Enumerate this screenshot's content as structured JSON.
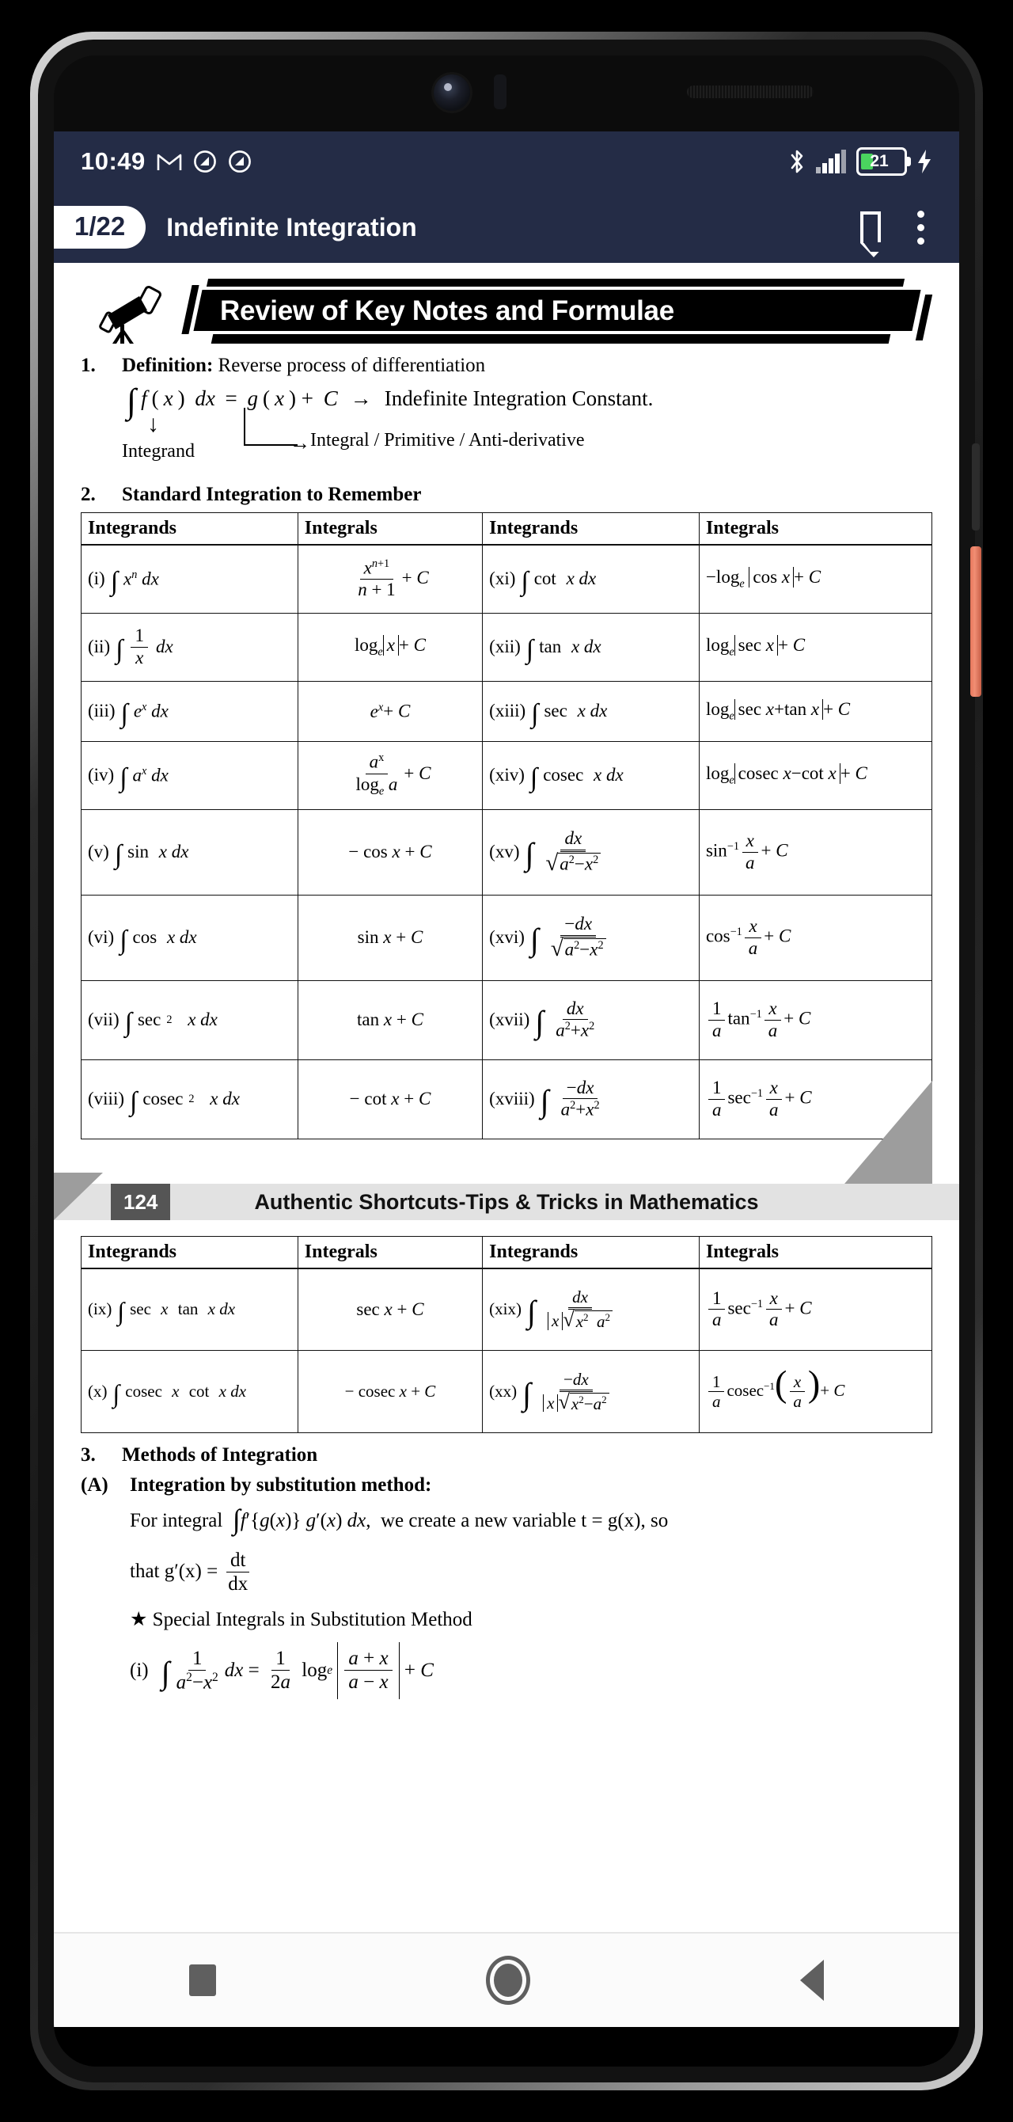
{
  "status_bar": {
    "time": "10:49",
    "left_icons": [
      "gmail-icon",
      "qr-app-icon",
      "qr-app-icon"
    ],
    "right_icons": [
      "bluetooth-icon",
      "signal-icon",
      "battery-icon",
      "charging-bolt-icon"
    ],
    "battery_percent": "21",
    "battery_color": "#4ad45f",
    "background": "#242c46"
  },
  "app_bar": {
    "page_badge": "1/22",
    "title": "Indefinite Integration",
    "bookmark_label": "bookmark-icon",
    "overflow_label": "more-options-icon"
  },
  "document": {
    "banner_title": "Review of Key Notes and Formulae",
    "section1": {
      "number": "1.",
      "label": "Definition:",
      "text": "Reverse process of differentiation",
      "equation_lhs": "∫ f(x) dx = g(x) + C",
      "equation_arrow": "→",
      "equation_rhs": "Indefinite Integration Constant.",
      "annot_integrand": "Integrand",
      "annot_integral": "Integral / Primitive / Anti-derivative"
    },
    "section2": {
      "number": "2.",
      "title": "Standard Integration to Remember",
      "headers": [
        "Integrands",
        "Integrals",
        "Integrands",
        "Integrals"
      ],
      "rows": [
        {
          "i1": "(i)",
          "f1": "∫ xⁿ dx",
          "r1": "x^(n+1)/(n+1) + C",
          "i2": "(xi)",
          "f2": "∫ cot x dx",
          "r2": "−log_e |cos x| + C"
        },
        {
          "i1": "(ii)",
          "f1": "∫ (1/x) dx",
          "r1": "log_e |x| + C",
          "i2": "(xii)",
          "f2": "∫ tan x dx",
          "r2": "log_e |sec x| + C"
        },
        {
          "i1": "(iii)",
          "f1": "∫ eˣ dx",
          "r1": "eˣ + C",
          "i2": "(xiii)",
          "f2": "∫ sec x dx",
          "r2": "log_e |sec x + tan x| + C"
        },
        {
          "i1": "(iv)",
          "f1": "∫ aˣ dx",
          "r1": "aˣ/log_e a + C",
          "i2": "(xiv)",
          "f2": "∫ cosec x dx",
          "r2": "log_e |cosec x − cot x| + C"
        },
        {
          "i1": "(v)",
          "f1": "∫ sin x dx",
          "r1": "− cos x + C",
          "i2": "(xv)",
          "f2": "∫ dx/√(a²−x²)",
          "r2": "sin⁻¹ (x/a) + C"
        },
        {
          "i1": "(vi)",
          "f1": "∫ cos x dx",
          "r1": "sin x + C",
          "i2": "(xvi)",
          "f2": "∫ −dx/√(a²−x²)",
          "r2": "cos⁻¹ (x/a) + C"
        },
        {
          "i1": "(vii)",
          "f1": "∫ sec² x dx",
          "r1": "tan x + C",
          "i2": "(xvii)",
          "f2": "∫ dx/(a²+x²)",
          "r2": "(1/a) tan⁻¹ (x/a) + C"
        },
        {
          "i1": "(viii)",
          "f1": "∫ cosec² x dx",
          "r1": "− cot x + C",
          "i2": "(xviii)",
          "f2": "∫ −dx/(a²+x²)",
          "r2": "(1/a) sec⁻¹ (x/a) + C"
        }
      ]
    },
    "page_footer": {
      "page_number": "124",
      "title": "Authentic Shortcuts-Tips & Tricks in Mathematics"
    },
    "table2": {
      "headers": [
        "Integrands",
        "Integrals",
        "Integrands",
        "Integrals"
      ],
      "rows": [
        {
          "i1": "(ix)",
          "f1": "∫ sec x tan x dx",
          "r1": "sec x + C",
          "i2": "(xix)",
          "f2": "∫ dx/(|x|√(x² a²))",
          "r2": "(1/a) sec⁻¹ (x/a) + C"
        },
        {
          "i1": "(x)",
          "f1": "∫ cosec x cot x dx",
          "r1": "− cosec x + C",
          "i2": "(xx)",
          "f2": "∫ −dx/(|x|√(x²−a²))",
          "r2": "(1/a) cosec⁻¹ (x/a) + C"
        }
      ]
    },
    "section3": {
      "number": "3.",
      "title": "Methods of Integration",
      "sub_label": "(A)",
      "sub_title": "Integration by substitution method:",
      "para_a": "For integral",
      "para_formula": "∫ f′{g(x)} g′(x) dx,",
      "para_b": "we create a new variable t = g(x), so",
      "para_c": "that  g′(x) =",
      "para_frac_n": "dt",
      "para_frac_d": "dx",
      "star": "★",
      "star_text": "Special Integrals in Substitution Method",
      "item_label": "(i)",
      "item_formula": "∫ 1/(a²−x²) dx = (1/2a) log_e |(a+x)/(a−x)| + C"
    }
  },
  "nav_bar": {
    "recents": "recents-square-icon",
    "home": "home-circle-icon",
    "back": "back-triangle-icon"
  }
}
